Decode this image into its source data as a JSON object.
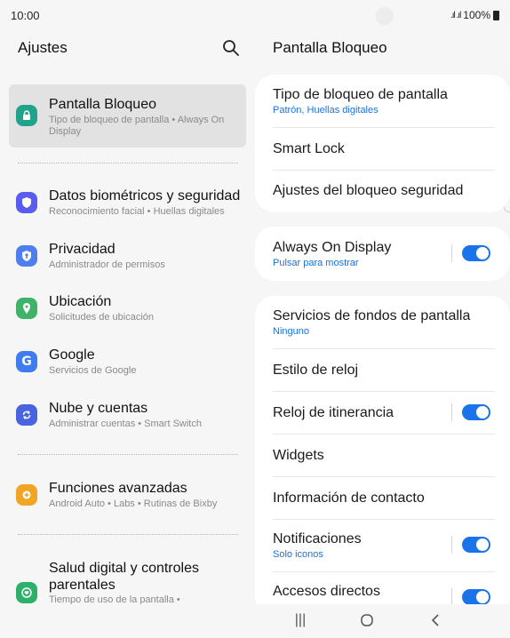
{
  "status": {
    "time": "10:00",
    "signal": ".ıl .ıl",
    "battery_text": "100%"
  },
  "left": {
    "title": "Ajustes",
    "items": [
      {
        "title": "Pantalla Bloqueo",
        "subtitle": "Tipo de bloqueo de pantalla  •  Always On Display",
        "icon": "lock-icon",
        "color": "#1fa38b"
      },
      {
        "title": "Datos biométricos y seguridad",
        "subtitle": "Reconocimiento facial  •  Huellas digitales",
        "icon": "shield-icon",
        "color": "#5a5cf0"
      },
      {
        "title": "Privacidad",
        "subtitle": "Administrador de permisos",
        "icon": "privacy-icon",
        "color": "#4f7ef0"
      },
      {
        "title": "Ubicación",
        "subtitle": "Solicitudes de ubicación",
        "icon": "location-icon",
        "color": "#3fb36a"
      },
      {
        "title": "Google",
        "subtitle": "Servicios de Google",
        "icon": "google-icon",
        "color": "#3f7cf0"
      },
      {
        "title": "Nube y cuentas",
        "subtitle": "Administrar cuentas  •  Smart Switch",
        "icon": "sync-icon",
        "color": "#4a63e0"
      },
      {
        "title": "Funciones avanzadas",
        "subtitle": "Android Auto  •  Labs  •  Rutinas de Bixby",
        "icon": "gear-plus-icon",
        "color": "#f2a424"
      },
      {
        "title": "Salud digital y controles parentales",
        "subtitle": "Tiempo de uso de la pantalla  •",
        "icon": "wellbeing-icon",
        "color": "#2fb06a"
      }
    ]
  },
  "right": {
    "title": "Pantalla Bloqueo",
    "card1": {
      "rows": [
        {
          "title": "Tipo de bloqueo de pantalla",
          "subtitle": "Patrón, Huellas digitales"
        },
        {
          "title": "Smart Lock"
        },
        {
          "title": "Ajustes del bloqueo seguridad"
        }
      ]
    },
    "card2": {
      "rows": [
        {
          "title": "Always On Display",
          "subtitle": "Pulsar para mostrar",
          "toggle": "on"
        }
      ]
    },
    "card3": {
      "rows": [
        {
          "title": "Servicios de fondos de pantalla",
          "subtitle": "Ninguno"
        },
        {
          "title": "Estilo de reloj"
        },
        {
          "title": "Reloj de itinerancia",
          "toggle": "on"
        },
        {
          "title": "Widgets"
        },
        {
          "title": "Información de contacto"
        },
        {
          "title": "Notificaciones",
          "subtitle": "Solo iconos",
          "toggle": "on"
        },
        {
          "title": "Accesos directos",
          "toggle": "on"
        }
      ]
    }
  },
  "nav": {
    "recents": "|||",
    "home": "○",
    "back": "<"
  },
  "colors": {
    "accent": "#1a73e8",
    "selected_bg": "#e2e2e2"
  }
}
